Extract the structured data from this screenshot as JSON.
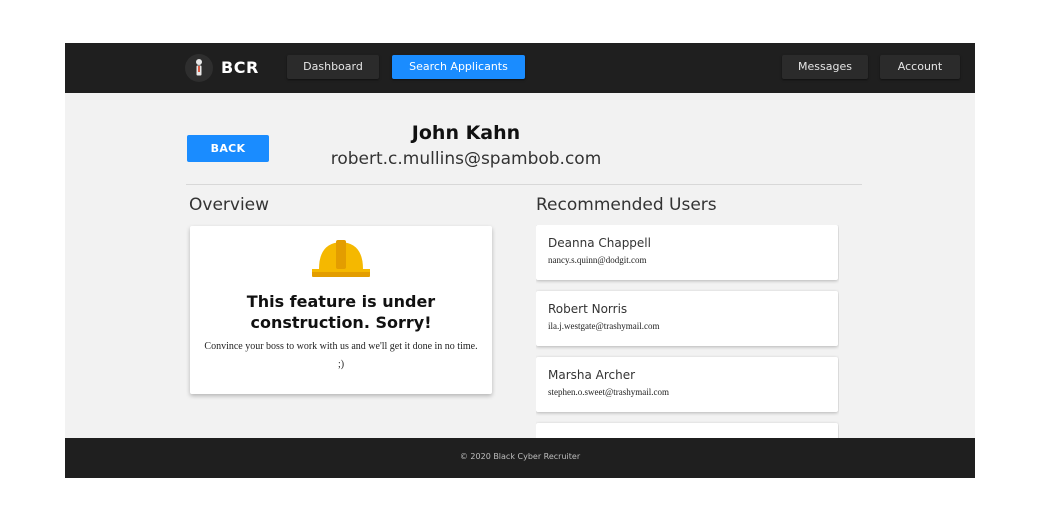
{
  "navbar": {
    "brand": "BCR",
    "logo_icon": "recruiter-figure-icon",
    "left_buttons": [
      {
        "label": "Dashboard",
        "active": false
      },
      {
        "label": "Search Applicants",
        "active": true
      }
    ],
    "right_buttons": [
      {
        "label": "Messages"
      },
      {
        "label": "Account"
      }
    ]
  },
  "profile": {
    "back_label": "BACK",
    "name": "John Kahn",
    "email": "robert.c.mullins@spambob.com"
  },
  "overview": {
    "title": "Overview",
    "icon": "hard-hat-icon",
    "construction_title": "This feature is under construction. Sorry!",
    "construction_text": "Convince your boss to work with us and we'll get it done in no time. ;)"
  },
  "recommended": {
    "title": "Recommended Users",
    "users": [
      {
        "name": "Deanna Chappell",
        "email": "nancy.s.quinn@dodgit.com"
      },
      {
        "name": "Robert Norris",
        "email": "ila.j.westgate@trashymail.com"
      },
      {
        "name": "Marsha Archer",
        "email": "stephen.o.sweet@trashymail.com"
      },
      {
        "name": "",
        "email": ""
      }
    ]
  },
  "footer": {
    "copyright": "© 2020 Black Cyber Recruiter"
  },
  "colors": {
    "accent": "#1a8cff",
    "navbar": "#1f1f1f",
    "background": "#f2f2f2",
    "helmet": "#f5b800"
  }
}
